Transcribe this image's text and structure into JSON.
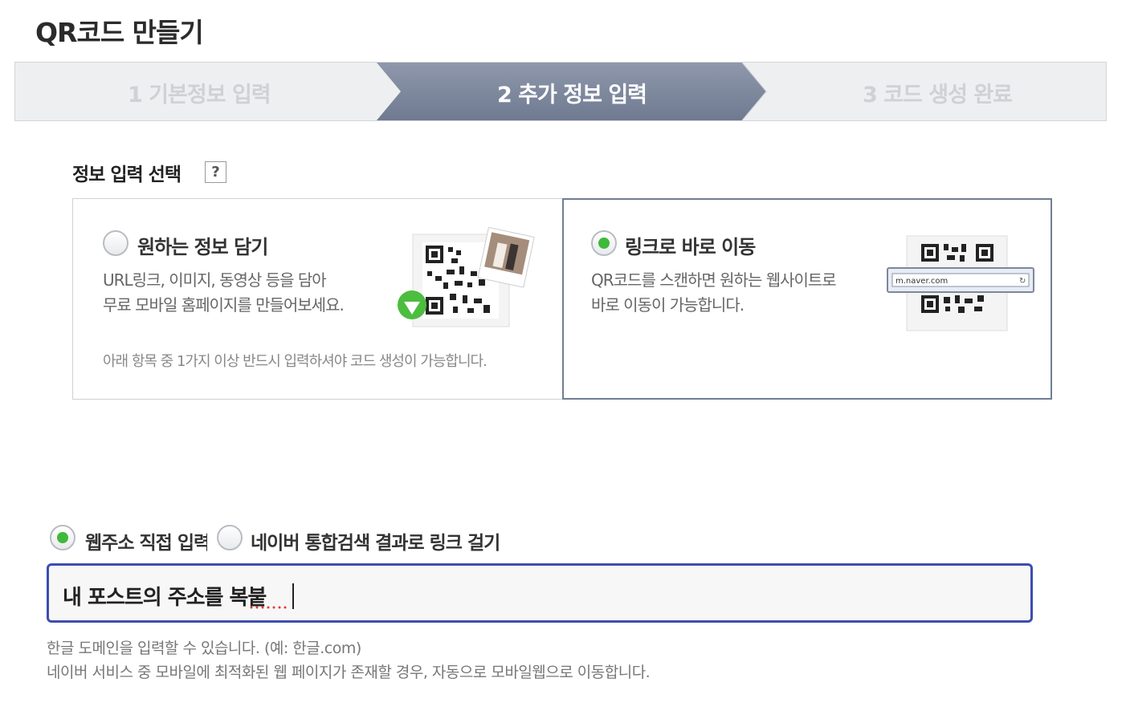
{
  "page": {
    "title": "QR코드 만들기"
  },
  "steps": [
    {
      "label": "1 기본정보 입력",
      "state": "done"
    },
    {
      "label": "2 추가 정보 입력",
      "state": "active"
    },
    {
      "label": "3 코드 생성 완료",
      "state": "pending"
    }
  ],
  "section": {
    "title": "정보 입력 선택",
    "help_icon": "?"
  },
  "options": [
    {
      "title": "원하는 정보 담기",
      "selected": false,
      "desc_line1": "URL링크, 이미지, 동영상 등을 담아",
      "desc_line2": "무료 모바일 홈페이지를 만들어보세요.",
      "note": "아래 항목 중 1가지 이상 반드시 입력하셔야 코드 생성이 가능합니다."
    },
    {
      "title": "링크로 바로 이동",
      "selected": true,
      "desc_line1": "QR코드를 스캔하면 원하는 웹사이트로",
      "desc_line2": "바로 이동이 가능합니다.",
      "illustration_url": "m.naver.com"
    }
  ],
  "link_type": {
    "direct": {
      "label": "웹주소 직접 입력",
      "selected": true
    },
    "search": {
      "label": "네이버 통합검색 결과로 링크 걸기",
      "selected": false
    }
  },
  "url_input": {
    "value": "내 포스트의 주소를 복붙"
  },
  "help": {
    "line1": "한글 도메인을 입력할 수 있습니다. (예: 한글.com)",
    "line2": "네이버 서비스 중 모바일에 최적화된 웹 페이지가 존재할 경우, 자동으로 모바일웹으로 이동합니다."
  },
  "colors": {
    "active_step": "#7d879d",
    "radio_on": "#3fb93a",
    "input_border": "#3d4db0"
  }
}
